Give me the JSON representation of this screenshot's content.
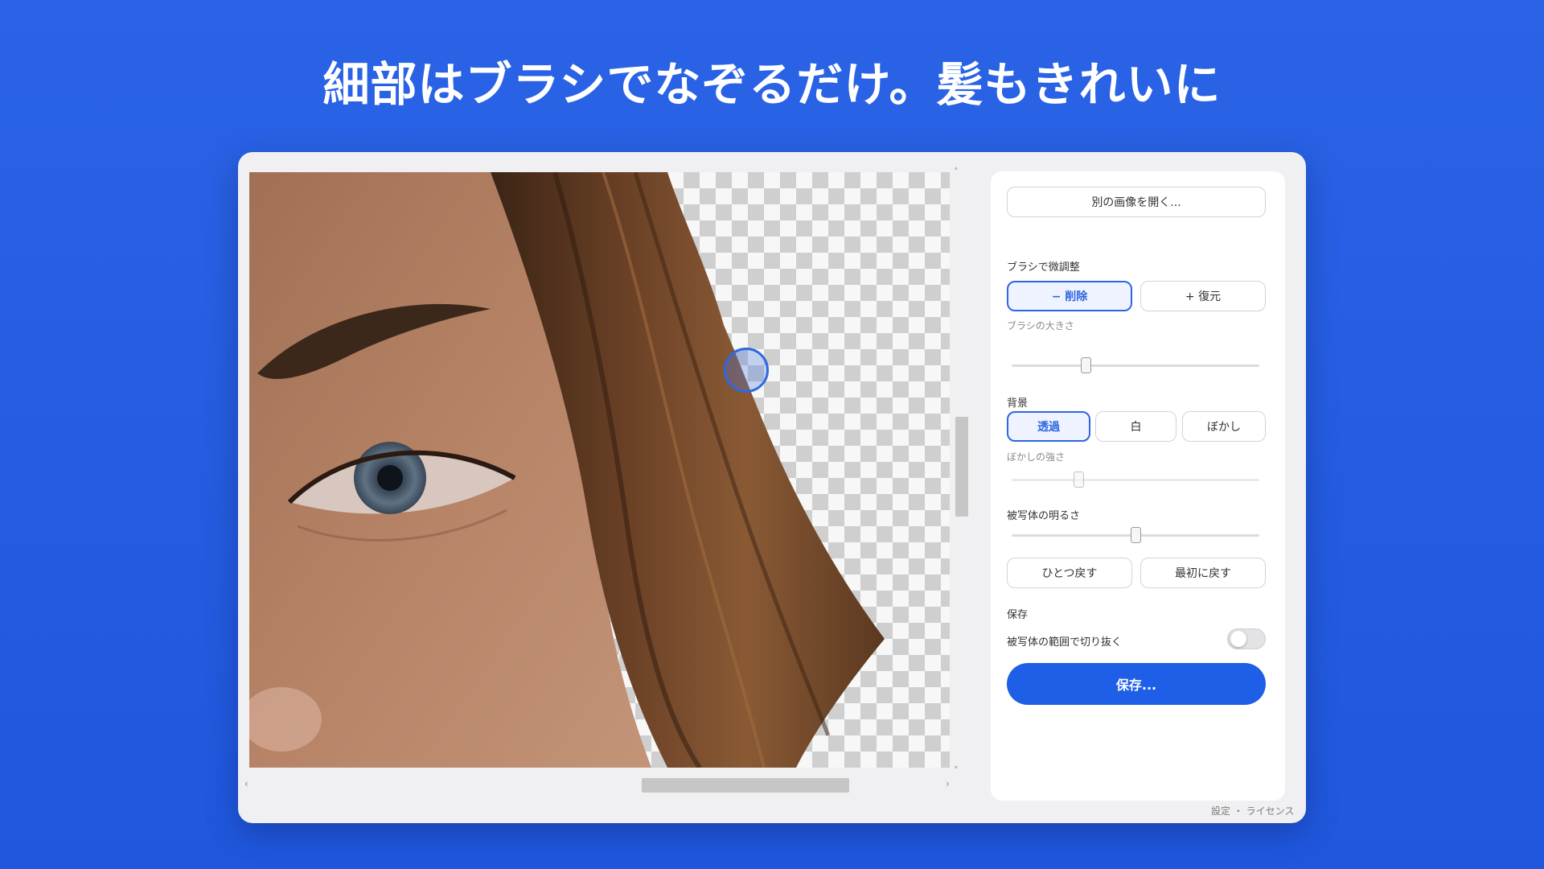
{
  "headline": "細部はブラシでなぞるだけ。髪もきれいに",
  "panel": {
    "open_button": "別の画像を開く...",
    "brush_section": "ブラシで微調整",
    "delete_button": "− 削除",
    "restore_button": "+ 復元",
    "brush_size_label": "ブラシの大きさ",
    "brush_size_value": 0.3,
    "background_section": "背景",
    "bg_transparent": "透過",
    "bg_white": "白",
    "bg_blur": "ぼかし",
    "blur_strength_label": "ぼかしの強さ",
    "blur_strength_value": 0.27,
    "subject_brightness_label": "被写体の明るさ",
    "subject_brightness_value": 0.5,
    "undo_button": "ひとつ戻す",
    "reset_button": "最初に戻す",
    "save_section": "保存",
    "crop_label": "被写体の範囲で切り抜く",
    "crop_toggle": false,
    "save_button": "保存..."
  },
  "scroll": {
    "up": "˄",
    "down": "˅",
    "left": "‹",
    "right": "›"
  },
  "footer": "設定 ・ ライセンス",
  "colors": {
    "background": "#2160e3",
    "accent": "#1f5ee6",
    "active_border": "#2d66e0"
  }
}
